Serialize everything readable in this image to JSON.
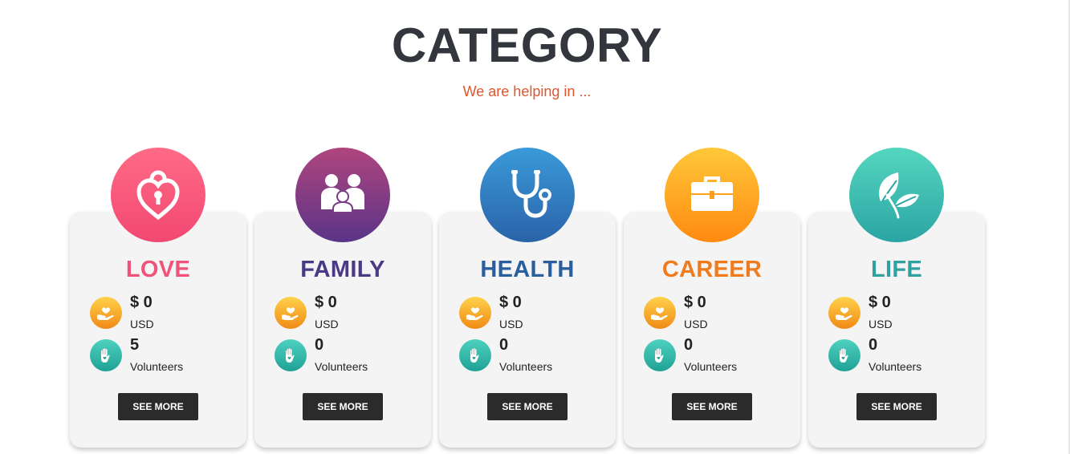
{
  "header": {
    "title": "CATEGORY",
    "subtitle": "We are helping in ..."
  },
  "categories": [
    {
      "name": "LOVE",
      "color": "#f0537a",
      "icon": "heart-lock-icon",
      "amount": "$ 0",
      "currency": "USD",
      "volunteers": "5",
      "volunteers_label": "Volunteers",
      "button": "SEE MORE"
    },
    {
      "name": "FAMILY",
      "color": "#4a3a86",
      "icon": "family-icon",
      "amount": "$ 0",
      "currency": "USD",
      "volunteers": "0",
      "volunteers_label": "Volunteers",
      "button": "SEE MORE"
    },
    {
      "name": "HEALTH",
      "color": "#2a5e9e",
      "icon": "stethoscope-icon",
      "amount": "$ 0",
      "currency": "USD",
      "volunteers": "0",
      "volunteers_label": "Volunteers",
      "button": "SEE MORE"
    },
    {
      "name": "CAREER",
      "color": "#ef7b1c",
      "icon": "briefcase-icon",
      "amount": "$ 0",
      "currency": "USD",
      "volunteers": "0",
      "volunteers_label": "Volunteers",
      "button": "SEE MORE"
    },
    {
      "name": "LIFE",
      "color": "#2fa2a0",
      "icon": "leaf-icon",
      "amount": "$ 0",
      "currency": "USD",
      "volunteers": "0",
      "volunteers_label": "Volunteers",
      "button": "SEE MORE"
    }
  ],
  "stat_icons": {
    "donation": "donation-hand-icon",
    "volunteer": "volunteer-hand-icon"
  }
}
